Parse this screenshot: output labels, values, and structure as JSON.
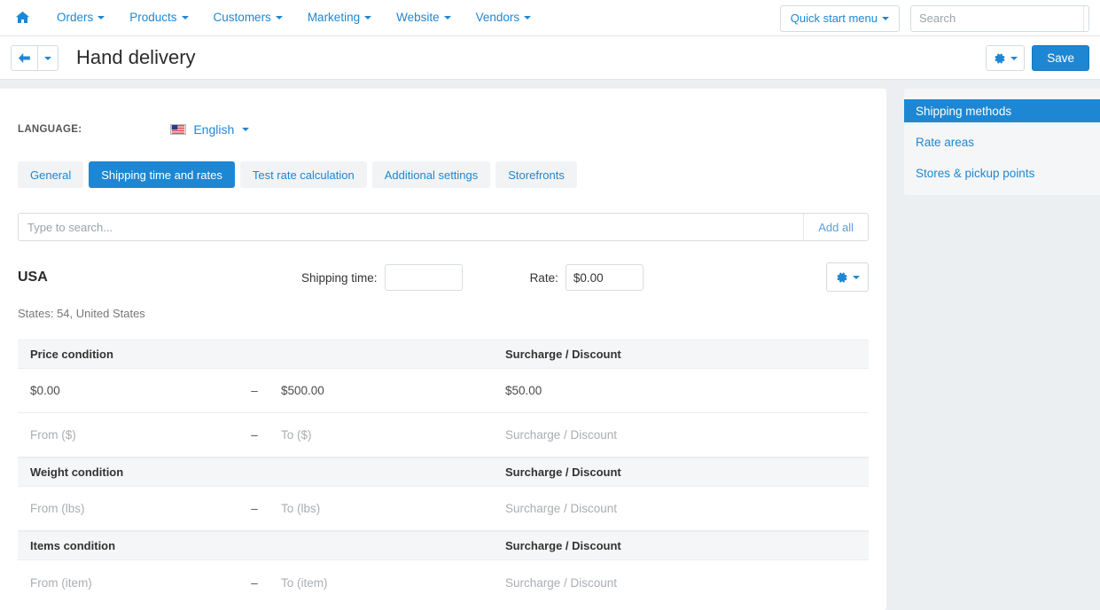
{
  "topnav": {
    "home_icon": "home-icon",
    "items": [
      {
        "label": "Orders"
      },
      {
        "label": "Products"
      },
      {
        "label": "Customers"
      },
      {
        "label": "Marketing"
      },
      {
        "label": "Website"
      },
      {
        "label": "Vendors"
      }
    ],
    "quick_start_label": "Quick start menu",
    "search_placeholder": "Search",
    "search_value": "",
    "search_icon": "search-icon"
  },
  "titlebar": {
    "back_icon": "arrow-left-icon",
    "title": "Hand delivery",
    "gear_icon": "gear-icon",
    "save_label": "Save"
  },
  "main": {
    "language_label": "LANGUAGE:",
    "language_value": "English",
    "language_flag": "us-flag-icon",
    "tabs": [
      {
        "label": "General",
        "active": false
      },
      {
        "label": "Shipping time and rates",
        "active": true
      },
      {
        "label": "Test rate calculation",
        "active": false
      },
      {
        "label": "Additional settings",
        "active": false
      },
      {
        "label": "Storefronts",
        "active": false
      }
    ],
    "search_placeholder": "Type to search...",
    "search_value": "",
    "add_all_label": "Add all",
    "area": {
      "name": "USA",
      "shipping_time_label": "Shipping time:",
      "shipping_time_value": "",
      "rate_label": "Rate:",
      "rate_value": "$0.00",
      "gear_icon": "gear-icon",
      "states_note": "States: 54, United States"
    },
    "conditions": [
      {
        "header_left": "Price condition",
        "header_right": "Surcharge / Discount",
        "rows": [
          {
            "from": "$0.00",
            "dash": "–",
            "to": "$500.00",
            "surcharge": "$50.00",
            "filled": true
          },
          {
            "from": "From ($)",
            "dash": "–",
            "to": "To ($)",
            "surcharge": "Surcharge / Discount",
            "filled": false
          }
        ]
      },
      {
        "header_left": "Weight condition",
        "header_right": "Surcharge / Discount",
        "rows": [
          {
            "from": "From (lbs)",
            "dash": "–",
            "to": "To (lbs)",
            "surcharge": "Surcharge / Discount",
            "filled": false
          }
        ]
      },
      {
        "header_left": "Items condition",
        "header_right": "Surcharge / Discount",
        "rows": [
          {
            "from": "From (item)",
            "dash": "–",
            "to": "To (item)",
            "surcharge": "Surcharge / Discount",
            "filled": false
          }
        ]
      }
    ]
  },
  "sidebar": {
    "items": [
      {
        "label": "Shipping methods",
        "active": true
      },
      {
        "label": "Rate areas",
        "active": false
      },
      {
        "label": "Stores & pickup points",
        "active": false
      }
    ]
  },
  "colors": {
    "accent": "#1e87d3",
    "page_bg": "#eceff1",
    "panel_bg": "#ffffff",
    "row_header_bg": "#f5f6f7",
    "placeholder": "#a9aeb3"
  }
}
